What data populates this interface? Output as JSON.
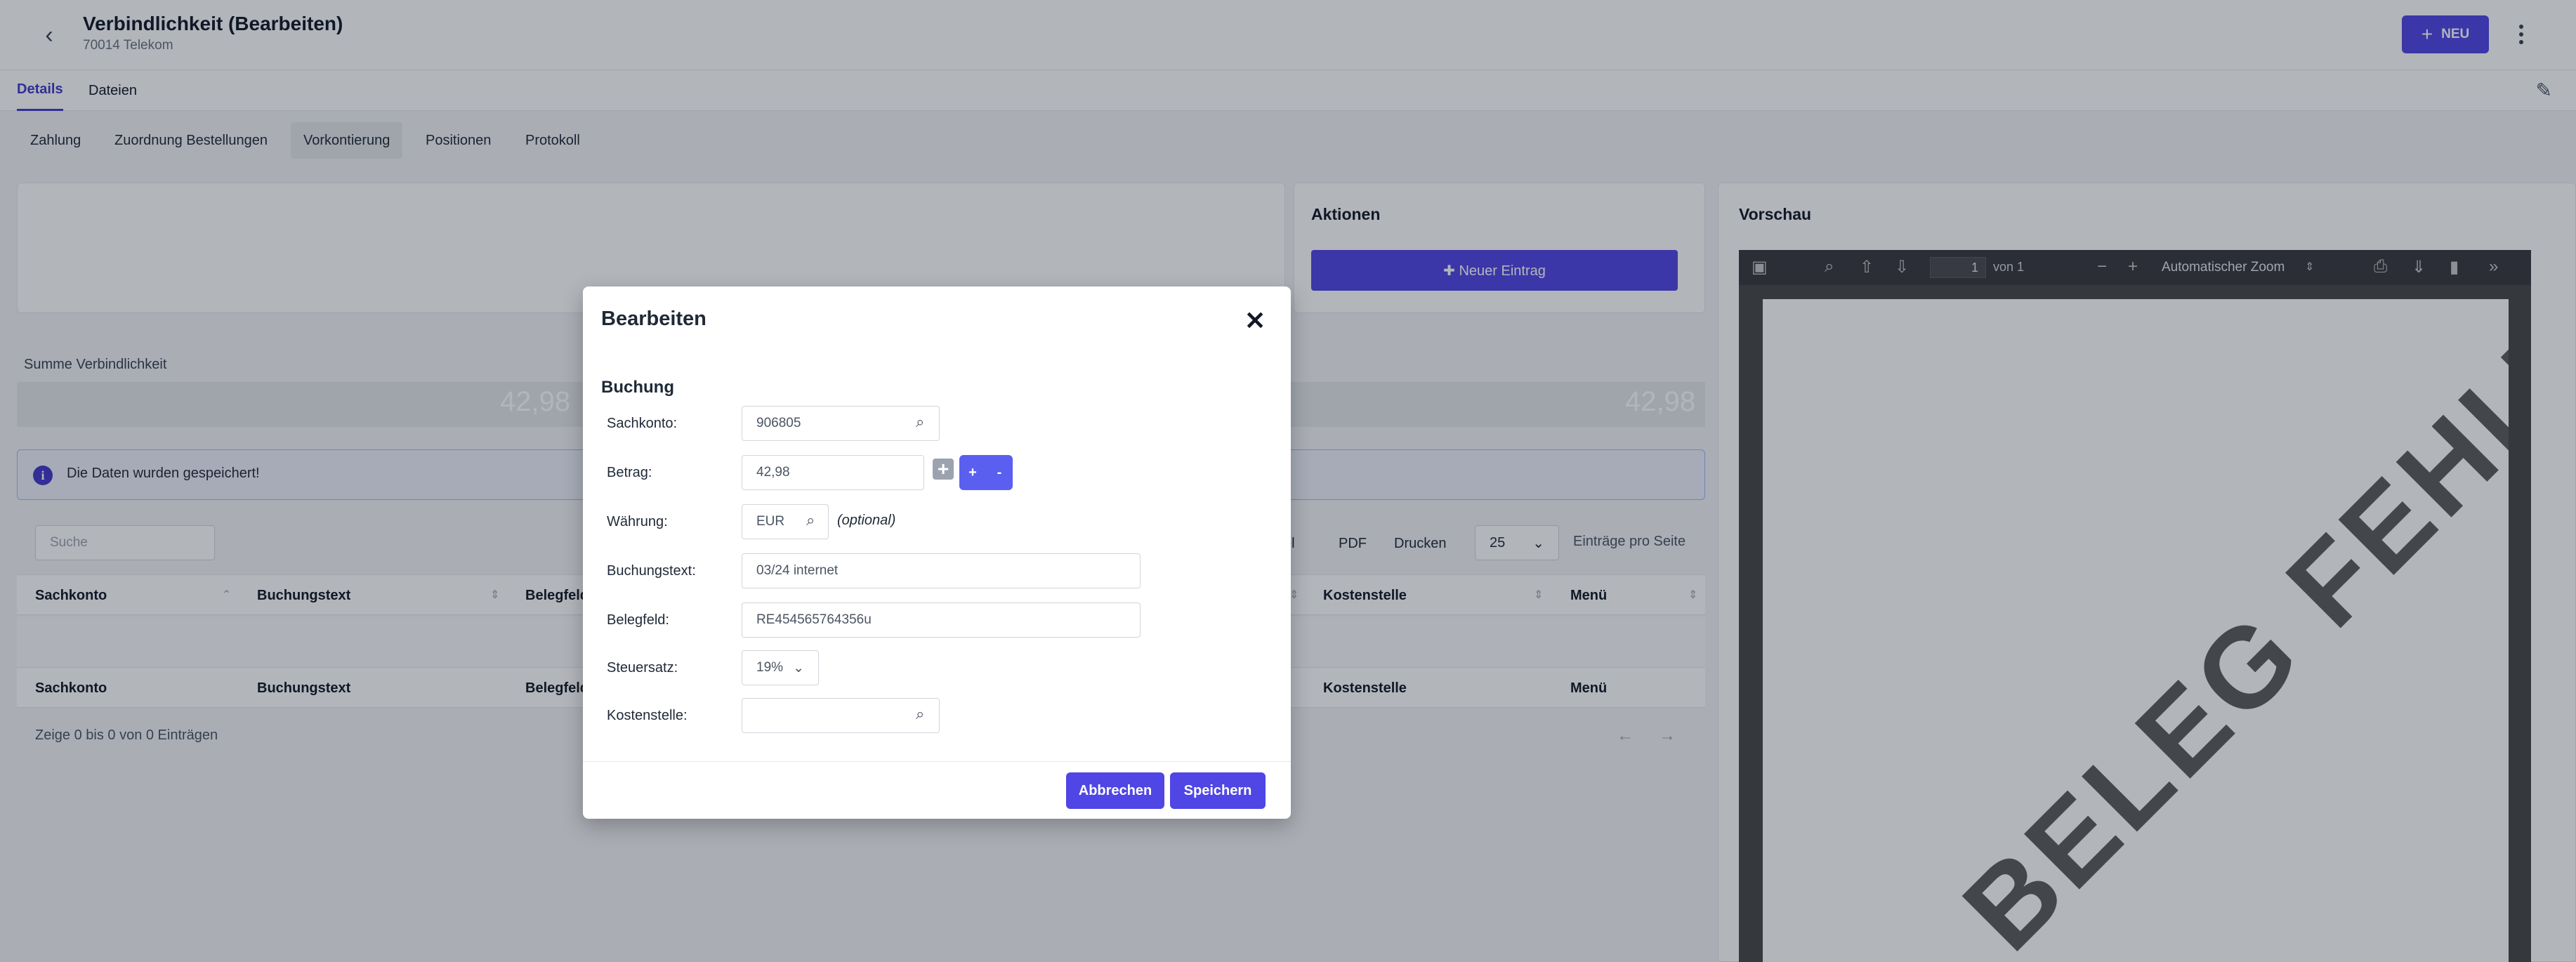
{
  "header": {
    "back_icon": "chevron-left-icon",
    "title": "Verbindlichkeit (Bearbeiten)",
    "subtitle": "70014 Telekom",
    "new_label": "NEU",
    "accent_color": "#5046e5"
  },
  "tabs": [
    {
      "label": "Details",
      "active": true
    },
    {
      "label": "Dateien",
      "active": false
    }
  ],
  "subtabs": [
    {
      "label": "Zahlung"
    },
    {
      "label": "Zuordnung Bestellungen"
    },
    {
      "label": "Vorkontierung",
      "active": true
    },
    {
      "label": "Positionen"
    },
    {
      "label": "Protokoll"
    }
  ],
  "actions": {
    "title": "Aktionen",
    "new_entry_label": "✚ Neuer Eintrag"
  },
  "summary": {
    "label": "Summe Verbindlichkeit",
    "value_left": "42,98",
    "value_right": "42,98"
  },
  "alert": {
    "text": "Die Daten wurden gespeichert!"
  },
  "table": {
    "search_placeholder": "Suche",
    "buttons": [
      "cel",
      "PDF",
      "Drucken"
    ],
    "page_size": "25",
    "page_size_label": "Einträge pro Seite",
    "columns": [
      "Sachkonto",
      "Buchungstext",
      "Belegfeld",
      "Kostenstelle",
      "Menü"
    ],
    "info": "Zeige 0 bis 0 von 0 Einträgen",
    "prev": "←",
    "next": "→"
  },
  "preview": {
    "title": "Vorschau",
    "page_number": "1",
    "page_of": "von 1",
    "zoom": "Automatischer Zoom",
    "watermark": "BELEG FEHLT"
  },
  "modal": {
    "title": "Bearbeiten",
    "close": "✕",
    "section": "Buchung",
    "fields": {
      "sachkonto_label": "Sachkonto:",
      "sachkonto_value": "906805",
      "betrag_label": "Betrag:",
      "betrag_value": "42,98",
      "plus_label": "+",
      "minus_label": "-",
      "waehrung_label": "Währung:",
      "waehrung_value": "EUR",
      "waehrung_hint": "(optional)",
      "buchungstext_label": "Buchungstext:",
      "buchungstext_value": "03/24 internet",
      "belegfeld_label": "Belegfeld:",
      "belegfeld_value": "RE454565764356u",
      "steuersatz_label": "Steuersatz:",
      "steuersatz_value": "19%",
      "kostenstelle_label": "Kostenstelle:",
      "kostenstelle_value": ""
    },
    "cancel_label": "Abbrechen",
    "save_label": "Speichern"
  }
}
